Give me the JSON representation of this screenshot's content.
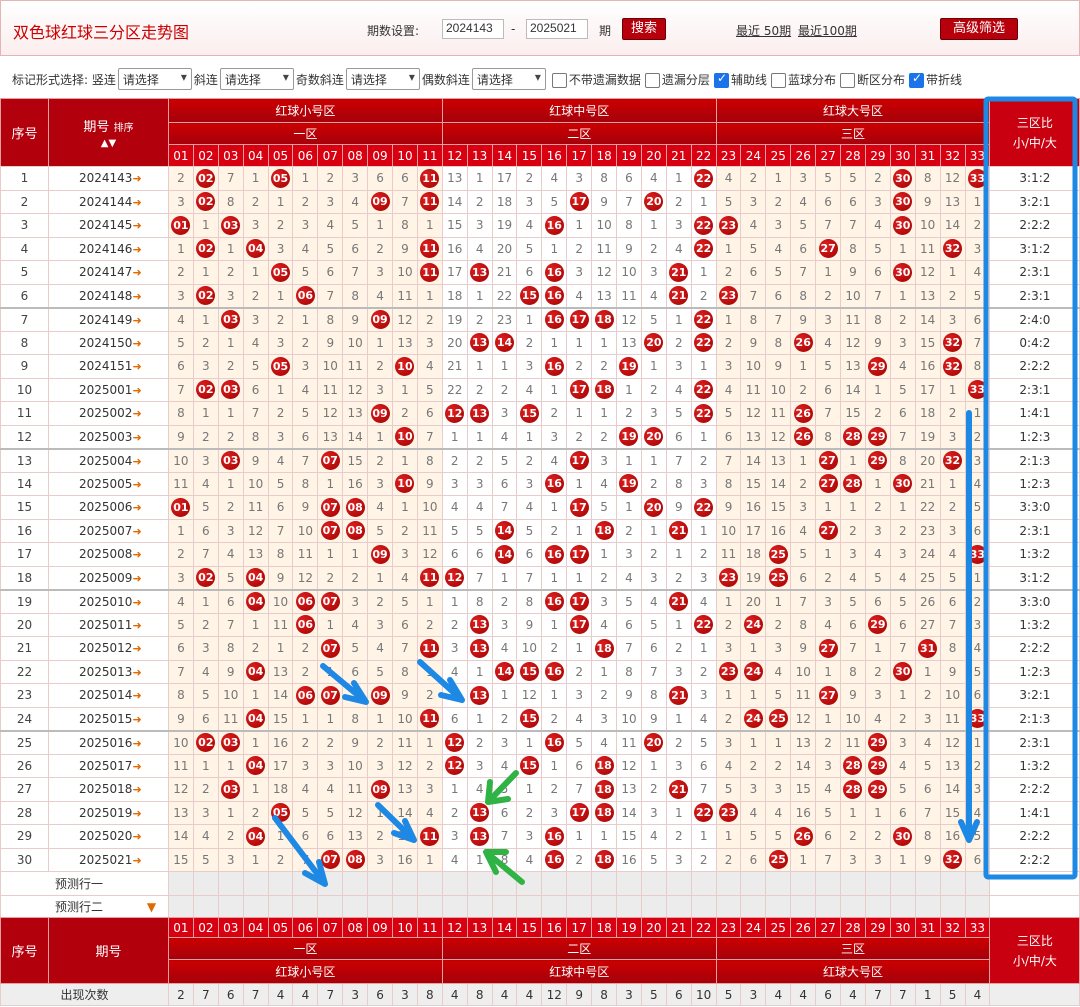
{
  "title": "双色球红球三分区走势图",
  "period": {
    "label": "期数设置:",
    "from": "2024143",
    "to": "2025021",
    "unit": "期",
    "search": "搜索",
    "recent50": "最近 50期",
    "recent100": "最近100期",
    "advanced": "高级筛选"
  },
  "markbar": {
    "label": "标记形式选择: 竖连",
    "select": "请选择",
    "diag": "斜连",
    "odd": "奇数斜连",
    "even": "偶数斜连",
    "checks": [
      {
        "label": "不带遗漏数据",
        "checked": false
      },
      {
        "label": "遗漏分层",
        "checked": false
      },
      {
        "label": "辅助线",
        "checked": true
      },
      {
        "label": "蓝球分布",
        "checked": false
      },
      {
        "label": "断区分布",
        "checked": false
      },
      {
        "label": "带折线",
        "checked": true
      }
    ]
  },
  "header": {
    "seq": "序号",
    "issue": "期号",
    "sort": "排序",
    "zones": [
      "红球小号区",
      "红球中号区",
      "红球大号区"
    ],
    "subzones": [
      "一区",
      "二区",
      "三区"
    ],
    "ratio": "三区比\n小/中/大",
    "numbers": [
      "01",
      "02",
      "03",
      "04",
      "05",
      "06",
      "07",
      "08",
      "09",
      "10",
      "11",
      "12",
      "13",
      "14",
      "15",
      "16",
      "17",
      "18",
      "19",
      "20",
      "21",
      "22",
      "23",
      "24",
      "25",
      "26",
      "27",
      "28",
      "29",
      "30",
      "31",
      "32",
      "33"
    ]
  },
  "rows": [
    {
      "n": "1",
      "issue": "2024143",
      "cells": [
        2,
        0,
        7,
        1,
        0,
        1,
        2,
        3,
        6,
        6,
        0,
        13,
        1,
        17,
        2,
        4,
        3,
        8,
        6,
        4,
        1,
        0,
        4,
        2,
        1,
        3,
        5,
        5,
        2,
        0,
        8,
        12,
        0
      ],
      "ratio": "3:1:2"
    },
    {
      "n": "2",
      "issue": "2024144",
      "cells": [
        3,
        0,
        8,
        2,
        1,
        2,
        3,
        4,
        0,
        7,
        0,
        14,
        2,
        18,
        3,
        5,
        0,
        9,
        7,
        0,
        2,
        1,
        5,
        3,
        2,
        4,
        6,
        6,
        3,
        0,
        9,
        13,
        1
      ],
      "ratio": "3:2:1"
    },
    {
      "n": "3",
      "issue": "2024145",
      "cells": [
        0,
        1,
        0,
        3,
        2,
        3,
        4,
        5,
        1,
        8,
        1,
        15,
        3,
        19,
        4,
        0,
        1,
        10,
        8,
        1,
        3,
        0,
        0,
        4,
        3,
        5,
        7,
        7,
        4,
        0,
        10,
        14,
        2
      ],
      "ratio": "2:2:2"
    },
    {
      "n": "4",
      "issue": "2024146",
      "cells": [
        1,
        0,
        1,
        0,
        3,
        4,
        5,
        6,
        2,
        9,
        0,
        16,
        4,
        20,
        5,
        1,
        2,
        11,
        9,
        2,
        4,
        0,
        1,
        5,
        4,
        6,
        0,
        8,
        5,
        1,
        11,
        0,
        3
      ],
      "ratio": "3:1:2"
    },
    {
      "n": "5",
      "issue": "2024147",
      "cells": [
        2,
        1,
        2,
        1,
        0,
        5,
        6,
        7,
        3,
        10,
        0,
        17,
        0,
        21,
        6,
        0,
        3,
        12,
        10,
        3,
        0,
        1,
        2,
        6,
        5,
        7,
        1,
        9,
        6,
        0,
        12,
        1,
        4
      ],
      "ratio": "2:3:1"
    },
    {
      "n": "6",
      "issue": "2024148",
      "cells": [
        3,
        0,
        3,
        2,
        1,
        0,
        7,
        8,
        4,
        11,
        1,
        18,
        1,
        22,
        0,
        0,
        4,
        13,
        11,
        4,
        0,
        2,
        0,
        7,
        6,
        8,
        2,
        10,
        7,
        1,
        13,
        2,
        5
      ],
      "ratio": "2:3:1"
    },
    {
      "n": "7",
      "issue": "2024149",
      "cells": [
        4,
        1,
        0,
        3,
        2,
        1,
        8,
        9,
        0,
        12,
        2,
        19,
        2,
        23,
        1,
        0,
        0,
        0,
        12,
        5,
        1,
        0,
        1,
        8,
        7,
        9,
        3,
        11,
        8,
        2,
        14,
        3,
        6
      ],
      "ratio": "2:4:0"
    },
    {
      "n": "8",
      "issue": "2024150",
      "cells": [
        5,
        2,
        1,
        4,
        3,
        2,
        9,
        10,
        1,
        13,
        3,
        20,
        0,
        0,
        2,
        1,
        1,
        1,
        13,
        0,
        2,
        0,
        2,
        9,
        8,
        0,
        4,
        12,
        9,
        3,
        15,
        0,
        7
      ],
      "ratio": "0:4:2"
    },
    {
      "n": "9",
      "issue": "2024151",
      "cells": [
        6,
        3,
        2,
        5,
        0,
        3,
        10,
        11,
        2,
        0,
        4,
        21,
        1,
        1,
        3,
        0,
        2,
        2,
        0,
        1,
        3,
        1,
        3,
        10,
        9,
        1,
        5,
        13,
        0,
        4,
        16,
        0,
        8
      ],
      "ratio": "2:2:2"
    },
    {
      "n": "10",
      "issue": "2025001",
      "cells": [
        7,
        0,
        0,
        6,
        1,
        4,
        11,
        12,
        3,
        1,
        5,
        22,
        2,
        2,
        4,
        1,
        0,
        0,
        1,
        2,
        4,
        0,
        4,
        11,
        10,
        2,
        6,
        14,
        1,
        5,
        17,
        1,
        0
      ],
      "ratio": "2:3:1"
    },
    {
      "n": "11",
      "issue": "2025002",
      "cells": [
        8,
        1,
        1,
        7,
        2,
        5,
        12,
        13,
        0,
        2,
        6,
        0,
        0,
        3,
        0,
        2,
        1,
        1,
        2,
        3,
        5,
        0,
        5,
        12,
        11,
        0,
        7,
        15,
        2,
        6,
        18,
        2,
        1
      ],
      "ratio": "1:4:1"
    },
    {
      "n": "12",
      "issue": "2025003",
      "cells": [
        9,
        2,
        2,
        8,
        3,
        6,
        13,
        14,
        1,
        0,
        7,
        1,
        1,
        4,
        1,
        3,
        2,
        2,
        0,
        0,
        6,
        1,
        6,
        13,
        12,
        0,
        8,
        0,
        0,
        7,
        19,
        3,
        2
      ],
      "ratio": "1:2:3"
    },
    {
      "n": "13",
      "issue": "2025004",
      "cells": [
        10,
        3,
        0,
        9,
        4,
        7,
        0,
        15,
        2,
        1,
        8,
        2,
        2,
        5,
        2,
        4,
        0,
        3,
        1,
        1,
        7,
        2,
        7,
        14,
        13,
        1,
        0,
        1,
        0,
        8,
        20,
        0,
        3
      ],
      "ratio": "2:1:3"
    },
    {
      "n": "14",
      "issue": "2025005",
      "cells": [
        11,
        4,
        1,
        10,
        5,
        8,
        1,
        16,
        3,
        0,
        9,
        3,
        3,
        6,
        3,
        0,
        1,
        4,
        0,
        2,
        8,
        3,
        8,
        15,
        14,
        2,
        0,
        0,
        1,
        0,
        21,
        1,
        4
      ],
      "ratio": "1:2:3"
    },
    {
      "n": "15",
      "issue": "2025006",
      "cells": [
        0,
        5,
        2,
        11,
        6,
        9,
        0,
        0,
        4,
        1,
        10,
        4,
        4,
        7,
        4,
        1,
        0,
        5,
        1,
        0,
        9,
        0,
        9,
        16,
        15,
        3,
        1,
        1,
        2,
        1,
        22,
        2,
        5
      ],
      "ratio": "3:3:0"
    },
    {
      "n": "16",
      "issue": "2025007",
      "cells": [
        1,
        6,
        3,
        12,
        7,
        10,
        0,
        0,
        5,
        2,
        11,
        5,
        5,
        0,
        5,
        2,
        1,
        0,
        2,
        1,
        0,
        1,
        10,
        17,
        16,
        4,
        0,
        2,
        3,
        2,
        23,
        3,
        6
      ],
      "ratio": "2:3:1"
    },
    {
      "n": "17",
      "issue": "2025008",
      "cells": [
        2,
        7,
        4,
        13,
        8,
        11,
        1,
        1,
        0,
        3,
        12,
        6,
        6,
        0,
        6,
        0,
        0,
        1,
        3,
        2,
        1,
        2,
        11,
        18,
        0,
        5,
        1,
        3,
        4,
        3,
        24,
        4,
        0
      ],
      "ratio": "1:3:2"
    },
    {
      "n": "18",
      "issue": "2025009",
      "cells": [
        3,
        0,
        5,
        0,
        9,
        12,
        2,
        2,
        1,
        4,
        0,
        0,
        7,
        1,
        7,
        1,
        1,
        2,
        4,
        3,
        2,
        3,
        0,
        19,
        0,
        6,
        2,
        4,
        5,
        4,
        25,
        5,
        1
      ],
      "ratio": "3:1:2"
    },
    {
      "n": "19",
      "issue": "2025010",
      "cells": [
        4,
        1,
        6,
        0,
        10,
        0,
        0,
        3,
        2,
        5,
        1,
        1,
        8,
        2,
        8,
        0,
        0,
        3,
        5,
        4,
        0,
        4,
        1,
        20,
        1,
        7,
        3,
        5,
        6,
        5,
        26,
        6,
        2
      ],
      "ratio": "3:3:0"
    },
    {
      "n": "20",
      "issue": "2025011",
      "cells": [
        5,
        2,
        7,
        1,
        11,
        0,
        1,
        4,
        3,
        6,
        2,
        2,
        0,
        3,
        9,
        1,
        0,
        4,
        6,
        5,
        1,
        0,
        2,
        0,
        2,
        8,
        4,
        6,
        0,
        6,
        27,
        7,
        3
      ],
      "ratio": "1:3:2"
    },
    {
      "n": "21",
      "issue": "2025012",
      "cells": [
        6,
        3,
        8,
        2,
        1,
        2,
        0,
        5,
        4,
        7,
        0,
        3,
        0,
        4,
        10,
        2,
        1,
        0,
        7,
        6,
        2,
        1,
        3,
        1,
        3,
        9,
        0,
        7,
        1,
        7,
        0,
        8,
        4
      ],
      "ratio": "2:2:2"
    },
    {
      "n": "22",
      "issue": "2025013",
      "cells": [
        7,
        4,
        9,
        0,
        13,
        2,
        1,
        6,
        5,
        8,
        1,
        4,
        1,
        0,
        0,
        0,
        2,
        1,
        8,
        7,
        3,
        2,
        0,
        0,
        4,
        10,
        1,
        8,
        2,
        0,
        1,
        9,
        5
      ],
      "ratio": "1:2:3"
    },
    {
      "n": "23",
      "issue": "2025014",
      "cells": [
        8,
        5,
        10,
        1,
        14,
        0,
        0,
        7,
        0,
        9,
        2,
        5,
        0,
        1,
        12,
        1,
        3,
        2,
        9,
        8,
        0,
        3,
        1,
        1,
        5,
        11,
        0,
        9,
        3,
        1,
        2,
        10,
        6
      ],
      "ratio": "3:2:1"
    },
    {
      "n": "24",
      "issue": "2025015",
      "cells": [
        9,
        6,
        11,
        0,
        15,
        1,
        1,
        8,
        1,
        10,
        0,
        6,
        1,
        2,
        0,
        2,
        4,
        3,
        10,
        9,
        1,
        4,
        2,
        0,
        0,
        12,
        1,
        10,
        4,
        2,
        3,
        11,
        0
      ],
      "ratio": "2:1:3"
    },
    {
      "n": "25",
      "issue": "2025016",
      "cells": [
        10,
        0,
        0,
        1,
        16,
        2,
        2,
        9,
        2,
        11,
        1,
        0,
        2,
        3,
        1,
        0,
        5,
        4,
        11,
        0,
        2,
        5,
        3,
        1,
        1,
        13,
        2,
        11,
        0,
        3,
        4,
        12,
        1
      ],
      "ratio": "2:3:1"
    },
    {
      "n": "26",
      "issue": "2025017",
      "cells": [
        11,
        1,
        1,
        0,
        17,
        3,
        3,
        10,
        3,
        12,
        2,
        0,
        3,
        4,
        0,
        1,
        6,
        0,
        12,
        1,
        3,
        6,
        4,
        2,
        2,
        14,
        3,
        0,
        0,
        4,
        5,
        13,
        2
      ],
      "ratio": "1:3:2"
    },
    {
      "n": "27",
      "issue": "2025018",
      "cells": [
        12,
        2,
        0,
        1,
        18,
        4,
        4,
        11,
        0,
        13,
        3,
        1,
        4,
        5,
        1,
        2,
        7,
        0,
        13,
        2,
        0,
        7,
        5,
        3,
        3,
        15,
        4,
        0,
        0,
        5,
        6,
        14,
        3
      ],
      "ratio": "2:2:2"
    },
    {
      "n": "28",
      "issue": "2025019",
      "cells": [
        13,
        3,
        1,
        2,
        0,
        5,
        5,
        12,
        1,
        14,
        4,
        2,
        0,
        6,
        2,
        3,
        0,
        0,
        14,
        3,
        1,
        0,
        0,
        4,
        4,
        16,
        5,
        1,
        1,
        6,
        7,
        15,
        4
      ],
      "ratio": "1:4:1"
    },
    {
      "n": "29",
      "issue": "2025020",
      "cells": [
        14,
        4,
        2,
        0,
        1,
        6,
        6,
        13,
        2,
        15,
        0,
        3,
        0,
        7,
        3,
        0,
        1,
        1,
        15,
        4,
        2,
        1,
        1,
        5,
        5,
        0,
        6,
        2,
        2,
        0,
        8,
        16,
        5
      ],
      "ratio": "2:2:2"
    },
    {
      "n": "30",
      "issue": "2025021",
      "cells": [
        15,
        5,
        3,
        1,
        2,
        7,
        0,
        0,
        3,
        16,
        1,
        4,
        1,
        8,
        4,
        0,
        2,
        0,
        16,
        5,
        3,
        2,
        2,
        6,
        0,
        1,
        7,
        3,
        3,
        1,
        9,
        0,
        6
      ],
      "ratio": "2:2:2"
    }
  ],
  "pred": [
    "预测行一",
    "预测行二"
  ],
  "footer": {
    "label": "出现次数",
    "counts": [
      2,
      7,
      6,
      7,
      4,
      4,
      7,
      3,
      6,
      3,
      8,
      4,
      8,
      4,
      4,
      12,
      9,
      8,
      3,
      5,
      6,
      10,
      5,
      3,
      4,
      4,
      6,
      4,
      7,
      7,
      1,
      5,
      4
    ]
  }
}
